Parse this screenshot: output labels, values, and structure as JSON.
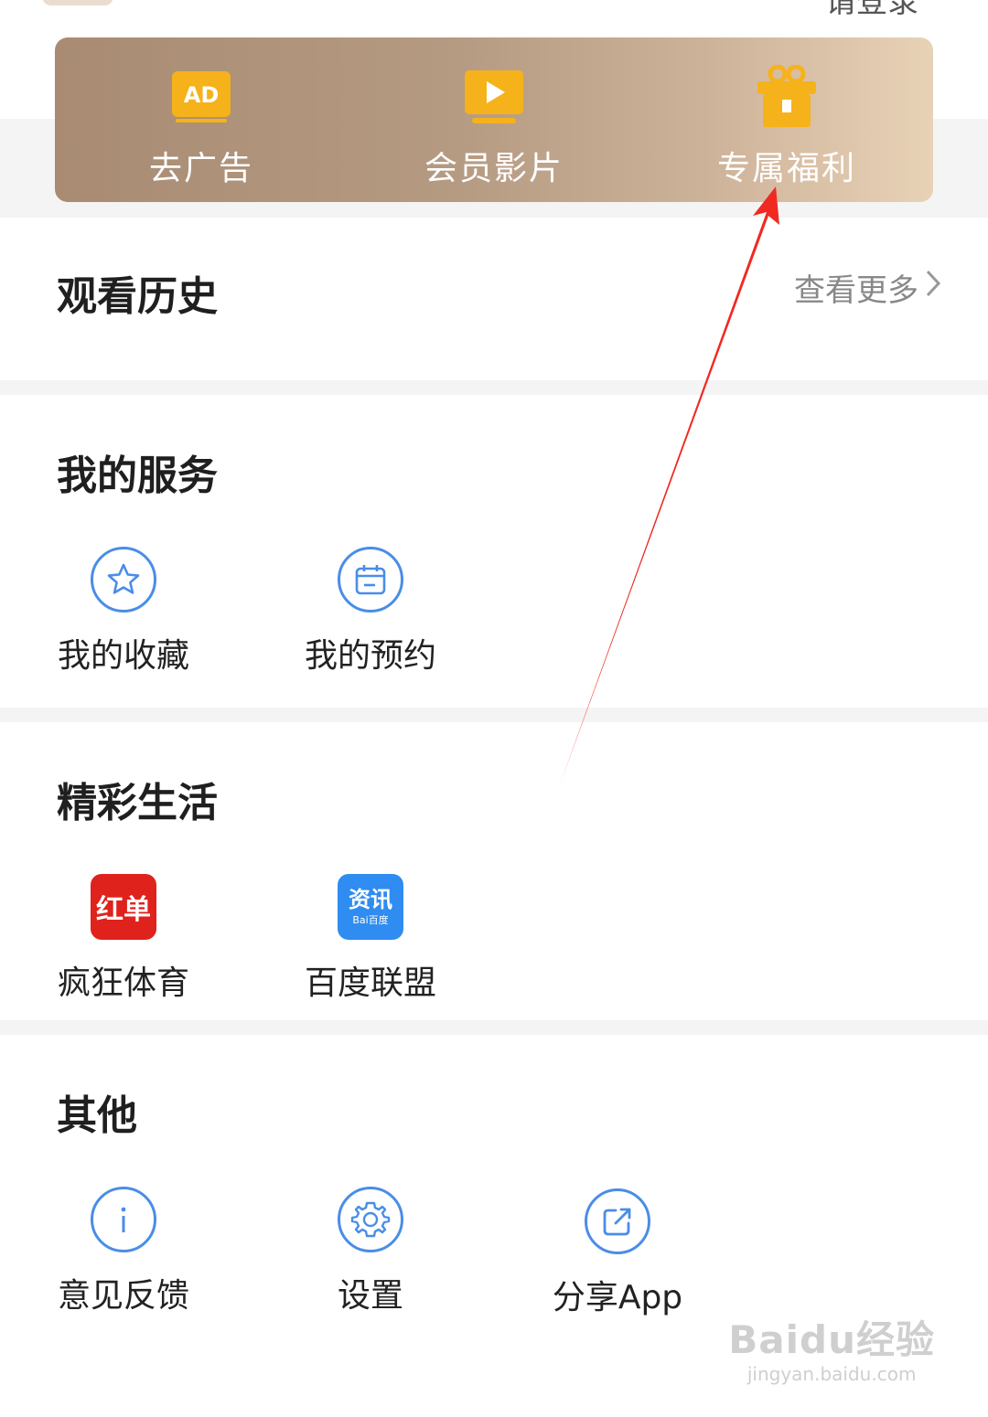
{
  "header": {
    "login": "请登录"
  },
  "vip_banner": {
    "items": [
      {
        "label": "去广告",
        "icon": "ad-icon",
        "badge": "AD"
      },
      {
        "label": "会员影片",
        "icon": "play-screen-icon"
      },
      {
        "label": "专属福利",
        "icon": "gift-icon"
      }
    ],
    "gradient": [
      "#a88b72",
      "#e8d2b6"
    ]
  },
  "history": {
    "title": "观看历史",
    "more": "查看更多"
  },
  "services": {
    "title": "我的服务",
    "items": [
      {
        "label": "我的收藏",
        "icon": "star-icon"
      },
      {
        "label": "我的预约",
        "icon": "calendar-icon"
      }
    ]
  },
  "life": {
    "title": "精彩生活",
    "items": [
      {
        "label": "疯狂体育",
        "icon": "hongdan-app-icon",
        "icon_text": "红单"
      },
      {
        "label": "百度联盟",
        "icon": "zixun-app-icon",
        "icon_text": "资讯",
        "icon_sub": "Bai百度"
      }
    ]
  },
  "other": {
    "title": "其他",
    "items": [
      {
        "label": "意见反馈",
        "icon": "info-icon"
      },
      {
        "label": "设置",
        "icon": "gear-icon"
      },
      {
        "label": "分享App",
        "icon": "share-icon"
      }
    ]
  },
  "watermark": {
    "main": "Baidu经验",
    "sub": "jingyan.baidu.com"
  },
  "colors": {
    "accent_blue": "#4a8de8",
    "annotation_red": "#f02a22",
    "vip_gold": "#f6b21b"
  }
}
